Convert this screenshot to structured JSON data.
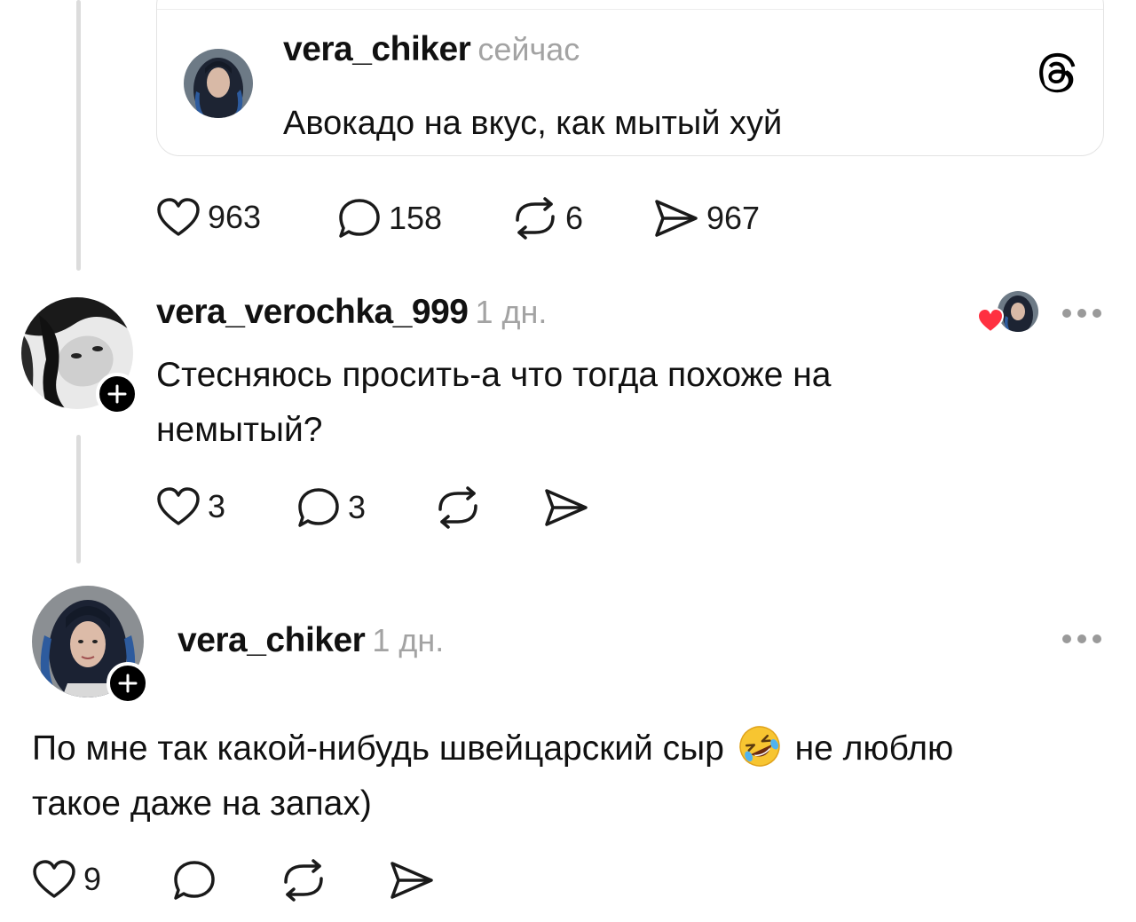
{
  "quoted_post": {
    "username": "vera_chiker",
    "time": "сейчас",
    "text": "Авокадо на вкус, как мытый хуй",
    "brand_icon": "threads-logo-icon"
  },
  "post_actions": {
    "likes": "963",
    "replies": "158",
    "reposts": "6",
    "shares": "967"
  },
  "reply_1": {
    "username": "vera_verochka_999",
    "time": "1 дн.",
    "text_line1": "Стесняюсь просить-а что тогда похоже на",
    "text_line2": "немытый?",
    "likes": "3",
    "replies": "3",
    "liked_by_author": "heart-icon"
  },
  "reply_2": {
    "username": "vera_chiker",
    "time": "1 дн.",
    "text_line1_before_emoji": "По мне так какой-нибудь швейцарский сыр",
    "emoji": "rolling-on-floor-laughing-emoji",
    "text_line1_after_emoji": "не люблю",
    "text_line2": "такое даже на запах)",
    "likes": "9"
  },
  "colors": {
    "text": "#111111",
    "muted": "#a3a3a3",
    "thread_line": "#dcdcdc",
    "heart_red": "#ff3040"
  }
}
